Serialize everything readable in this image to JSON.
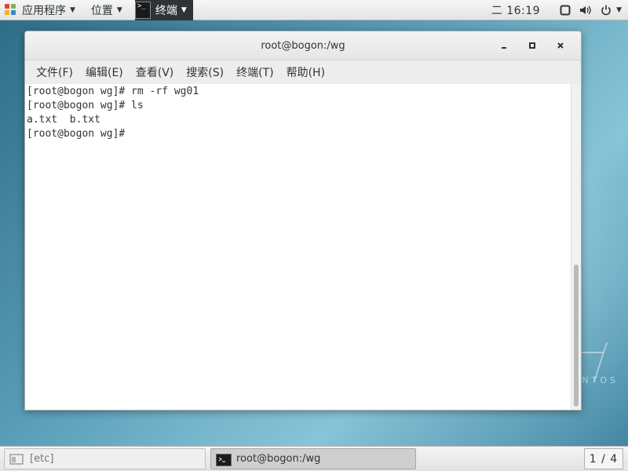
{
  "top_panel": {
    "applications_label": "应用程序",
    "places_label": "位置",
    "active_task_label": "终端",
    "clock": "二 16:19"
  },
  "window": {
    "title": "root@bogon:/wg",
    "controls": {
      "minimize": "−",
      "maximize": "□",
      "close": "×"
    }
  },
  "menubar": {
    "items": [
      "文件(F)",
      "编辑(E)",
      "查看(V)",
      "搜索(S)",
      "终端(T)",
      "帮助(H)"
    ]
  },
  "terminal": {
    "lines": [
      "[root@bogon wg]# rm -rf wg01",
      "[root@bogon wg]# ls",
      "a.txt  b.txt",
      "[root@bogon wg]# "
    ]
  },
  "desktop": {
    "watermark": "NTOS"
  },
  "bottom_panel": {
    "tasks": [
      {
        "label": "[etc]"
      },
      {
        "label": "root@bogon:/wg"
      }
    ],
    "workspace": "1 / 4"
  },
  "colors": {
    "panel_bg": "#ececec",
    "terminal_bg": "#ffffff",
    "terminal_fg": "#2e3436",
    "desktop_accent": "#4f8fa9"
  }
}
